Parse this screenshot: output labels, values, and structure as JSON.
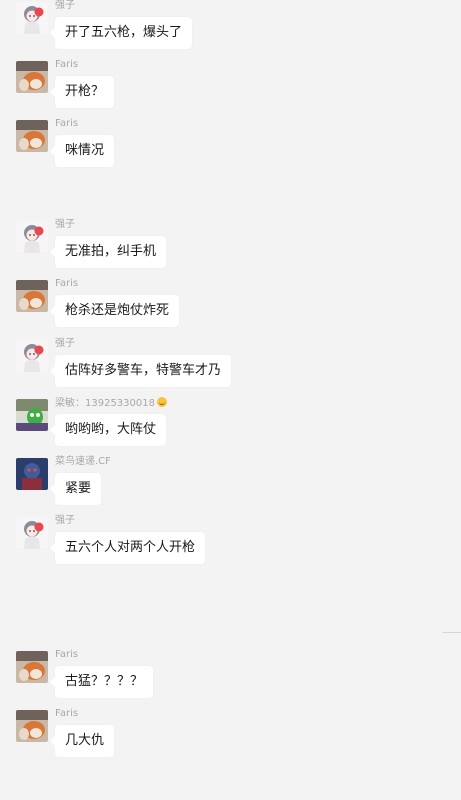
{
  "messages": [
    {
      "sender": "强子",
      "avatar": "anime-girl-avatar-icon",
      "text": "开了五六枪，爆头了",
      "emoji": false
    },
    {
      "sender": "Faris",
      "avatar": "cat-photo-avatar-icon",
      "text": "开枪？",
      "emoji": false
    },
    {
      "sender": "Faris",
      "avatar": "cat-photo-avatar-icon",
      "text": "咪情况",
      "emoji": false
    },
    {
      "sender": "强子",
      "avatar": "anime-girl-avatar-icon",
      "text": "无准拍，纠手机",
      "emoji": false
    },
    {
      "sender": "Faris",
      "avatar": "cat-photo-avatar-icon",
      "text": "枪杀还是炮仗炸死",
      "emoji": false
    },
    {
      "sender": "强子",
      "avatar": "anime-girl-avatar-icon",
      "text": "估阵好多警车，特警车才乃",
      "emoji": false
    },
    {
      "sender": "梁敏：13925330018",
      "avatar": "green-character-avatar-icon",
      "text": "哟哟哟，大阵仗",
      "emoji": true
    },
    {
      "sender": "菜鸟速递.CF",
      "avatar": "game-character-avatar-icon",
      "text": "紧要",
      "emoji": false
    },
    {
      "sender": "强子",
      "avatar": "anime-girl-avatar-icon",
      "text": "五六个人对两个人开枪",
      "emoji": false
    },
    {
      "sender": "Faris",
      "avatar": "cat-photo-avatar-icon",
      "text": "古猛？？？？",
      "emoji": false
    },
    {
      "sender": "Faris",
      "avatar": "cat-photo-avatar-icon",
      "text": "几大仇",
      "emoji": false
    }
  ],
  "colors": {
    "background": "#f3f3f3",
    "bubble": "#ffffff",
    "sender_name": "#a8a8a8",
    "text": "#1a1a1a"
  }
}
